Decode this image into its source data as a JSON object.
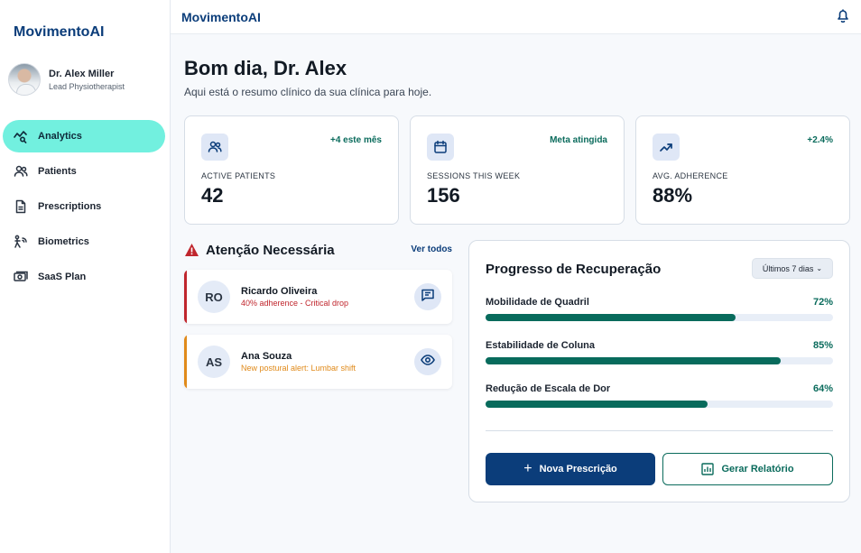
{
  "sidebar": {
    "brand": "MovimentoAI",
    "profile": {
      "name": "Dr. Alex Miller",
      "role": "Lead Physiotherapist"
    },
    "items": [
      {
        "label": "Analytics",
        "icon": "analytics-icon",
        "active": true
      },
      {
        "label": "Patients",
        "icon": "patients-icon"
      },
      {
        "label": "Prescriptions",
        "icon": "prescriptions-icon"
      },
      {
        "label": "Biometrics",
        "icon": "biometrics-icon"
      },
      {
        "label": "SaaS Plan",
        "icon": "saas-plan-icon"
      }
    ]
  },
  "topbar": {
    "title": "MovimentoAI",
    "icon": "bell-icon"
  },
  "header": {
    "greeting": "Bom dia, Dr. Alex",
    "subtitle": "Aqui está o resumo clínico da sua clínica para hoje."
  },
  "stats": [
    {
      "label": "ACTIVE PATIENTS",
      "value": "42",
      "badge": "+4 este mês",
      "icon": "users-icon"
    },
    {
      "label": "SESSIONS THIS WEEK",
      "value": "156",
      "badge": "Meta atingida",
      "icon": "calendar-icon"
    },
    {
      "label": "AVG. ADHERENCE",
      "value": "88%",
      "badge": "+2.4%",
      "icon": "trending-up-icon"
    }
  ],
  "attention": {
    "title": "Atenção Necessária",
    "see_all": "Ver todos",
    "alerts": [
      {
        "initials": "RO",
        "name": "Ricardo Oliveira",
        "desc": "40% adherence - Critical drop",
        "color": "#c0262d",
        "icon": "message-icon"
      },
      {
        "initials": "AS",
        "name": "Ana Souza",
        "desc": "New postural alert: Lumbar shift",
        "color": "#e08a1a",
        "icon": "eye-icon"
      }
    ]
  },
  "progress": {
    "title": "Progresso de Recuperação",
    "range": "Últimos 7 dias",
    "metrics": [
      {
        "label": "Mobilidade de Quadril",
        "value": "72%",
        "fraction": 0.72
      },
      {
        "label": "Estabilidade de Coluna",
        "value": "85%",
        "fraction": 0.85
      },
      {
        "label": "Redução de Escala de Dor",
        "value": "64%",
        "fraction": 0.64
      }
    ],
    "primary_button": "Nova Prescrição",
    "secondary_button": "Gerar Relatório"
  },
  "colors": {
    "brand": "#0b3d7a",
    "accent": "#72f0df",
    "success": "#0a6b5c"
  }
}
